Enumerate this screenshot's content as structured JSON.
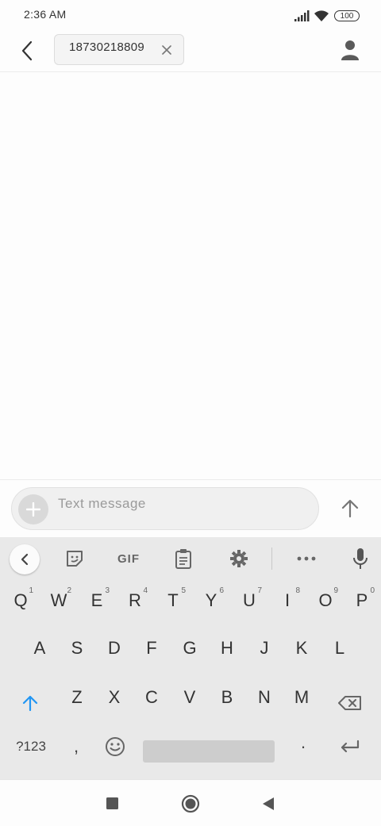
{
  "status_bar": {
    "time": "2:36 AM",
    "battery": "100"
  },
  "header": {
    "recipient": "18730218809"
  },
  "compose": {
    "placeholder": "Text message"
  },
  "keyboard": {
    "toolbar": {
      "gif_label": "GIF"
    },
    "rows": [
      [
        {
          "label": "Q",
          "hint": "1"
        },
        {
          "label": "W",
          "hint": "2"
        },
        {
          "label": "E",
          "hint": "3"
        },
        {
          "label": "R",
          "hint": "4"
        },
        {
          "label": "T",
          "hint": "5"
        },
        {
          "label": "Y",
          "hint": "6"
        },
        {
          "label": "U",
          "hint": "7"
        },
        {
          "label": "I",
          "hint": "8"
        },
        {
          "label": "O",
          "hint": "9"
        },
        {
          "label": "P",
          "hint": "0"
        }
      ],
      [
        {
          "label": "A"
        },
        {
          "label": "S"
        },
        {
          "label": "D"
        },
        {
          "label": "F"
        },
        {
          "label": "G"
        },
        {
          "label": "H"
        },
        {
          "label": "J"
        },
        {
          "label": "K"
        },
        {
          "label": "L"
        }
      ],
      [
        {
          "label": "Z"
        },
        {
          "label": "X"
        },
        {
          "label": "C"
        },
        {
          "label": "V"
        },
        {
          "label": "B"
        },
        {
          "label": "N"
        },
        {
          "label": "M"
        }
      ]
    ],
    "symbols_label": "?123",
    "comma_label": ",",
    "period_label": "·"
  },
  "icons": {
    "back": "back-arrow-icon",
    "chip_remove": "close-icon",
    "contact": "person-icon",
    "attach": "plus-icon",
    "send": "send-arrow-up-icon",
    "collapse": "chevron-left-icon",
    "sticker": "sticker-icon",
    "clipboard": "clipboard-icon",
    "settings": "gear-icon",
    "more": "more-horizontal-icon",
    "mic": "microphone-icon",
    "shift": "shift-arrow-icon",
    "backspace": "backspace-icon",
    "emoji": "emoji-icon",
    "enter": "enter-icon",
    "recents": "square-icon",
    "home": "circle-icon",
    "nav_back": "triangle-back-icon"
  },
  "colors": {
    "accent": "#2196f3",
    "keyboard_bg": "#e9e9e9",
    "compose_bg": "#f0f0f0"
  }
}
